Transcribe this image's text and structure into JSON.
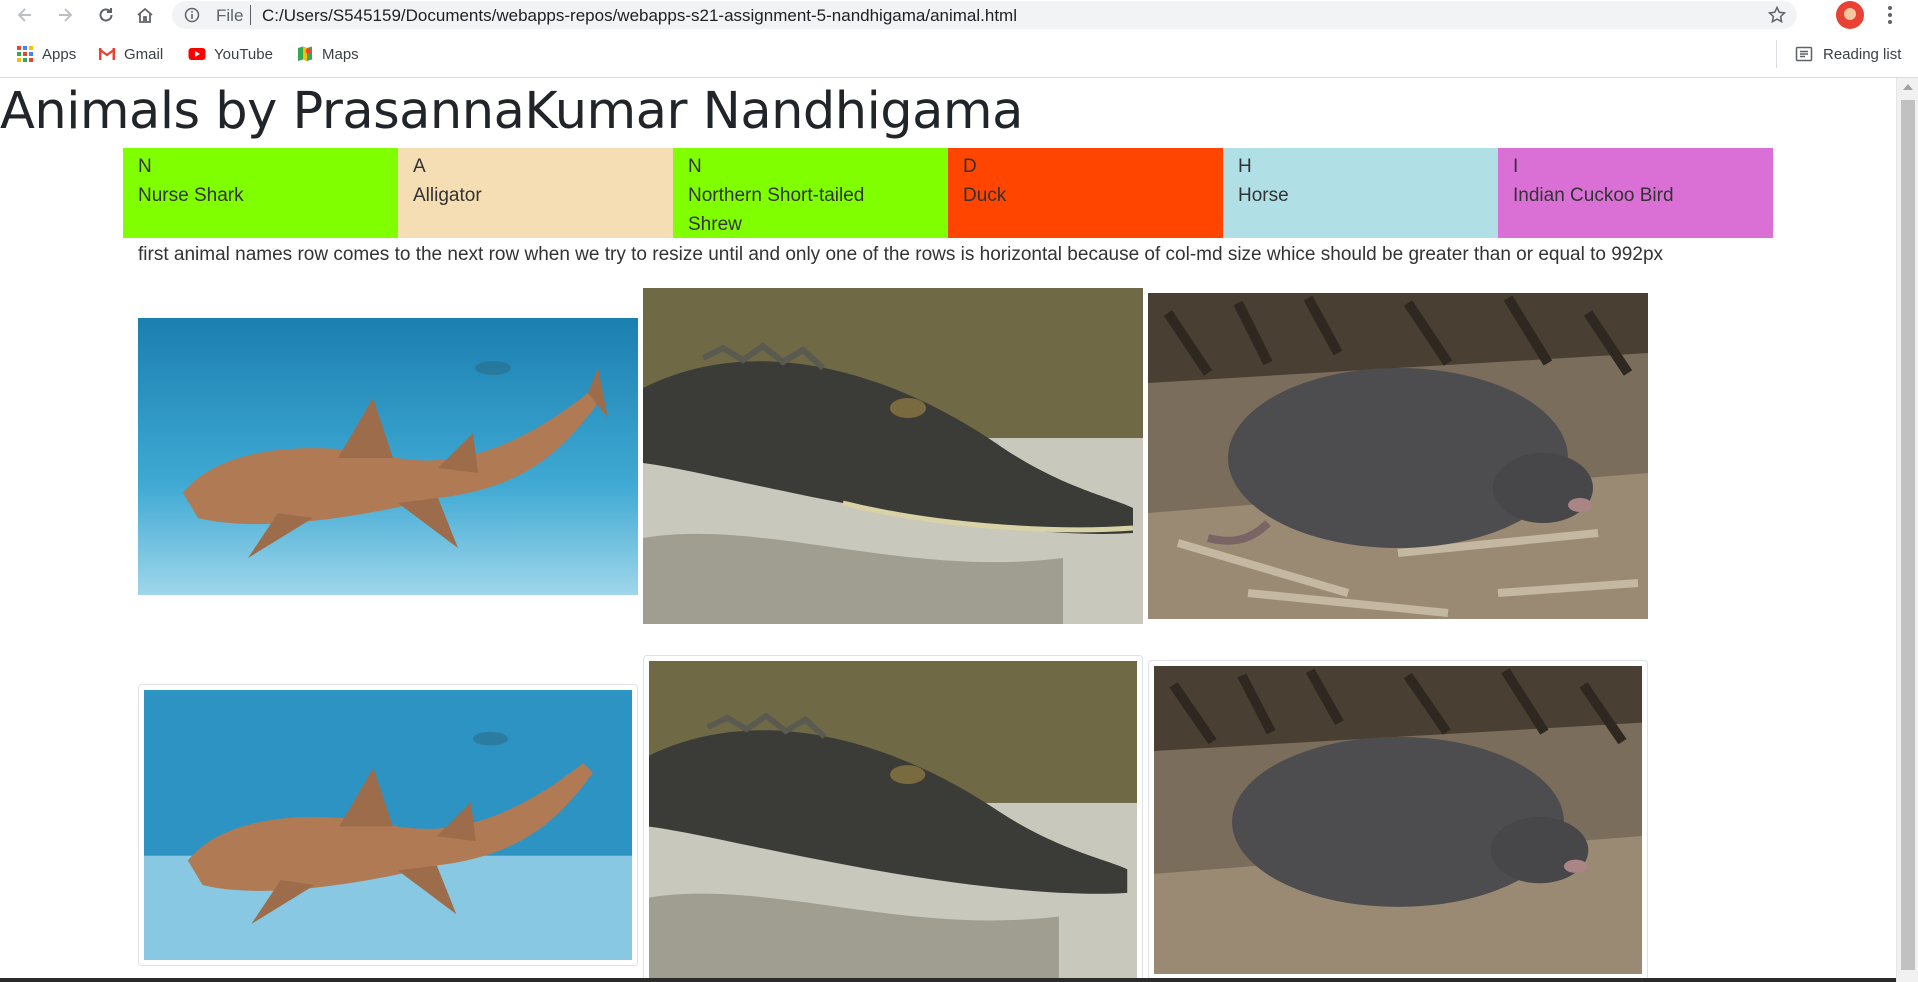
{
  "browser": {
    "url_scheme": "File",
    "url": "C:/Users/S545159/Documents/webapps-repos/webapps-s21-assignment-5-nandhigama/animal.html",
    "bookmarks": [
      {
        "label": "Apps",
        "icon": "apps-grid-icon"
      },
      {
        "label": "Gmail",
        "icon": "gmail-icon"
      },
      {
        "label": "YouTube",
        "icon": "youtube-icon"
      },
      {
        "label": "Maps",
        "icon": "maps-icon"
      }
    ],
    "reading_list": "Reading list"
  },
  "page": {
    "title": "Animals by PrasannaKumar Nandhigama",
    "animals": [
      {
        "letter": "N",
        "name": "Nurse Shark",
        "color": "#7fff00"
      },
      {
        "letter": "A",
        "name": "Alligator",
        "color": "#f5deb3"
      },
      {
        "letter": "N",
        "name": "Northern Short-tailed Shrew",
        "color": "#7fff00"
      },
      {
        "letter": "D",
        "name": "Duck",
        "color": "#ff4500"
      },
      {
        "letter": "H",
        "name": "Horse",
        "color": "#b0e0e6"
      },
      {
        "letter": "I",
        "name": "Indian Cuckoo Bird",
        "color": "#da70d6"
      }
    ],
    "note": "first animal names row comes to the next row when we try to resize until and only one of the rows is horizontal because of col-md size whice should be greater than or equal to 992px"
  }
}
